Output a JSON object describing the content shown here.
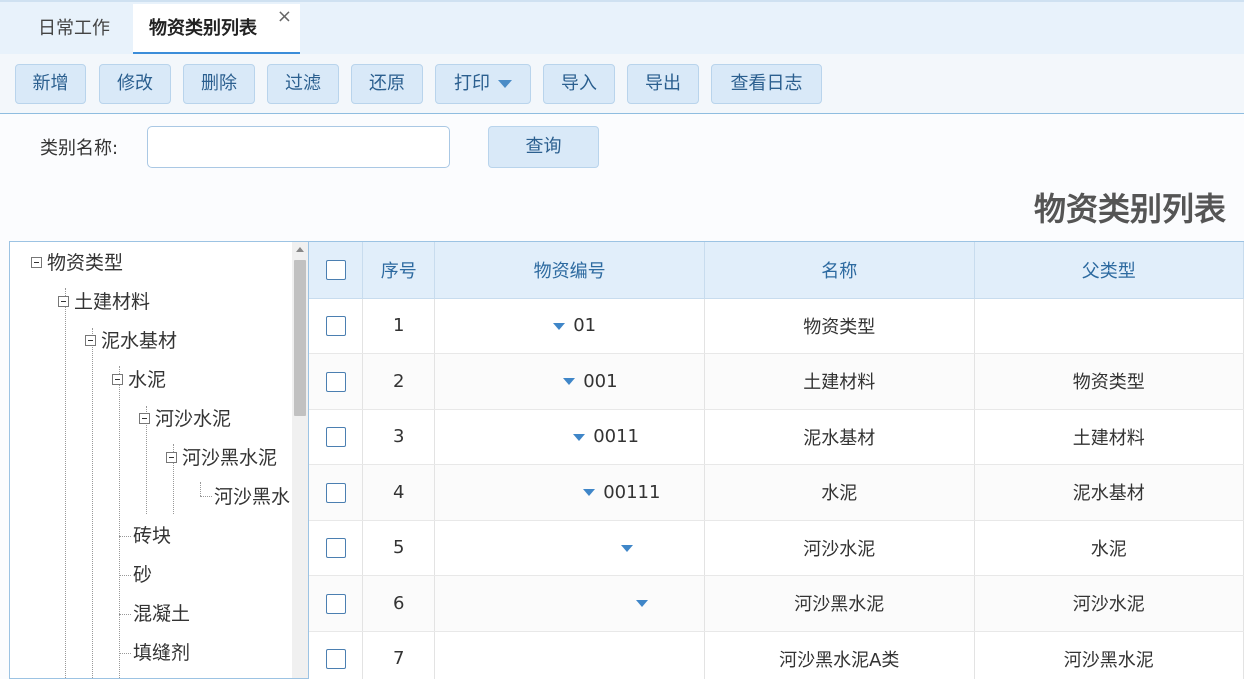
{
  "tabs": [
    {
      "label": "日常工作"
    },
    {
      "label": "物资类别列表",
      "close": "×"
    }
  ],
  "toolbar": {
    "add": "新增",
    "edit": "修改",
    "delete": "删除",
    "filter": "过滤",
    "restore": "还原",
    "print": "打印",
    "import": "导入",
    "export": "导出",
    "log": "查看日志"
  },
  "search": {
    "label": "类别名称:",
    "value": "",
    "button": "查询"
  },
  "page_title": "物资类别列表",
  "tree": {
    "nodes": [
      {
        "label": "物资类型"
      },
      {
        "label": "土建材料"
      },
      {
        "label": "泥水基材"
      },
      {
        "label": "水泥"
      },
      {
        "label": "河沙水泥"
      },
      {
        "label": "河沙黑水泥"
      },
      {
        "label": "河沙黑水"
      },
      {
        "label": "砖块"
      },
      {
        "label": "砂"
      },
      {
        "label": "混凝土"
      },
      {
        "label": "填缝剂"
      }
    ]
  },
  "grid": {
    "headers": {
      "index": "序号",
      "code": "物资编号",
      "name": "名称",
      "parent": "父类型"
    },
    "rows": [
      {
        "index": "1",
        "code": "01",
        "name": "物资类型",
        "parent": ""
      },
      {
        "index": "2",
        "code": "001",
        "name": "土建材料",
        "parent": "物资类型"
      },
      {
        "index": "3",
        "code": "0011",
        "name": "泥水基材",
        "parent": "土建材料"
      },
      {
        "index": "4",
        "code": "00111",
        "name": "水泥",
        "parent": "泥水基材"
      },
      {
        "index": "5",
        "code": "",
        "name": "河沙水泥",
        "parent": "水泥"
      },
      {
        "index": "6",
        "code": "",
        "name": "河沙黑水泥",
        "parent": "河沙水泥"
      },
      {
        "index": "7",
        "code": "",
        "name": "河沙黑水泥A类",
        "parent": "河沙黑水泥"
      }
    ]
  }
}
